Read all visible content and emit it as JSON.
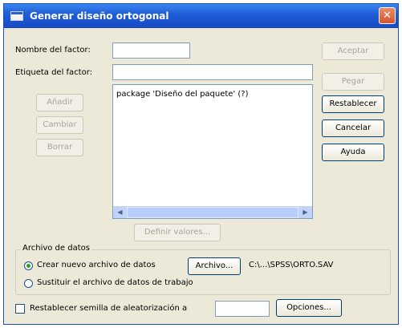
{
  "window": {
    "title": "Generar diseño ortogonal"
  },
  "labels": {
    "factor_name": "Nombre del factor:",
    "factor_label": "Etiqueta del factor:"
  },
  "inputs": {
    "factor_name": "",
    "factor_label": ""
  },
  "left_buttons": {
    "add": "Añadir",
    "change": "Cambiar",
    "remove": "Borrar"
  },
  "factor_list": {
    "items": [
      "package 'Diseño del paquete' (?)"
    ]
  },
  "define_values_button": "Definir valores...",
  "right_buttons": {
    "accept": "Aceptar",
    "paste": "Pegar",
    "reset": "Restablecer",
    "cancel": "Cancelar",
    "help": "Ayuda"
  },
  "data_file": {
    "group_title": "Archivo de datos",
    "option_new": "Crear nuevo archivo de datos",
    "file_button": "Archivo...",
    "file_path": "C:\\...\\SPSS\\ORTO.SAV",
    "option_replace": "Sustituir el archivo de datos de trabajo"
  },
  "seed": {
    "label": "Restablecer semilla de aleatorización a",
    "value": "",
    "options_button": "Opciones..."
  },
  "state": {
    "option_new_selected": true,
    "seed_checked": false
  }
}
